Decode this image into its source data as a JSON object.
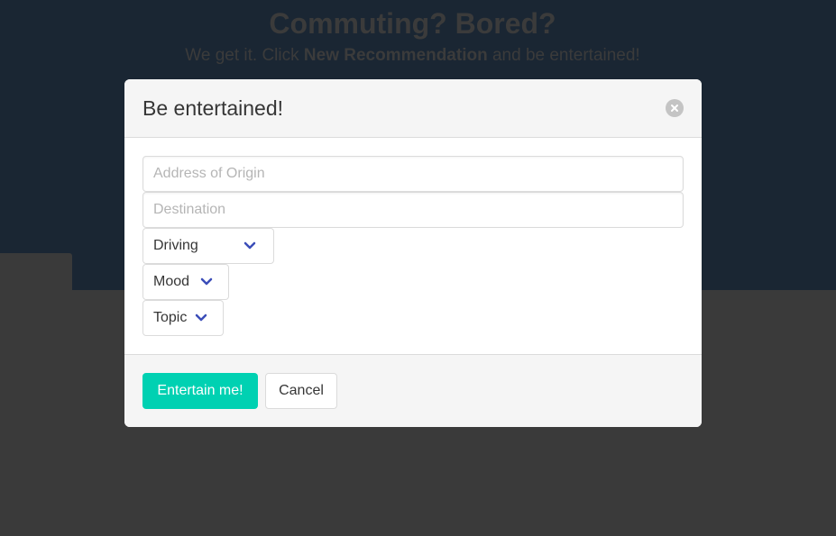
{
  "page": {
    "hero_title": "Commuting? Bored?",
    "hero_sub_before": "We get it. Click ",
    "hero_sub_bold": "New Recommendation",
    "hero_sub_after": " and be entertained!"
  },
  "modal": {
    "title": "Be entertained!",
    "origin_placeholder": "Address of Origin",
    "destination_placeholder": "Destination",
    "transport_select": "Driving",
    "mood_select": "Mood",
    "topic_select": "Topic",
    "submit_label": "Entertain me!",
    "cancel_label": "Cancel"
  },
  "colors": {
    "primary": "#00d1b2",
    "chevron": "#3b4db8",
    "close": "#c4c4c4"
  },
  "icons": {
    "close": "close-icon",
    "dropdown": "chevron-down-icon"
  }
}
